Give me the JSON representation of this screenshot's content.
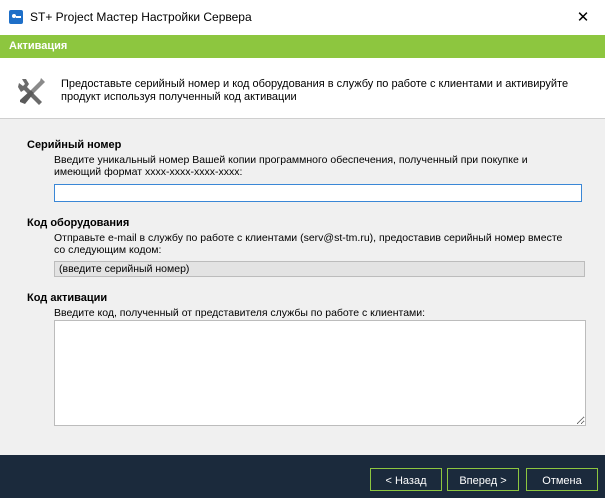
{
  "window": {
    "title": "ST+ Project Мастер Настройки Сервера",
    "close_glyph": "✕",
    "app_icon": "app-logo-icon"
  },
  "banner": {
    "title": "Активация",
    "color": "#8dc63f"
  },
  "info": {
    "icon": "tools-icon",
    "text": "Предоставьте серийный номер и код оборудования в службу по работе с клиентами и активируйте продукт используя полученный код активации"
  },
  "serial": {
    "title": "Серийный номер",
    "description": "Введите уникальный номер Вашей копии программного обеспечения, полученный при покупке и имеющий формат xxxx-xxxx-xxxx-xxxx:",
    "value": ""
  },
  "hardware": {
    "title": "Код оборудования",
    "description": "Отправьте e-mail в службу по работе с клиентами (serv@st-tm.ru), предоставив серийный номер вместе со следующим кодом:",
    "value": "(введите серийный номер)"
  },
  "activation": {
    "title": "Код активации",
    "description": "Введите код, полученный от представителя службы по работе с клиентами:",
    "value": ""
  },
  "footer": {
    "back_label": "< Назад",
    "next_label": "Вперед >",
    "cancel_label": "Отмена",
    "background": "#1b2a3c"
  }
}
